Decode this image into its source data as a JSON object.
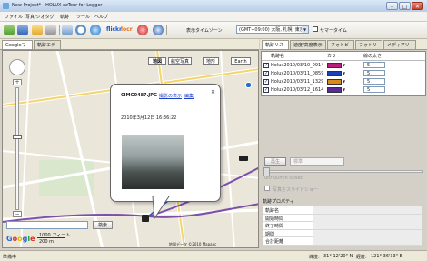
{
  "window": {
    "title": "New Project* - HOLUX ezTour for Logger",
    "minimize": "–",
    "maximize": "□",
    "close": "✕"
  },
  "menu": [
    "ファイル",
    "写真/ジオタグ",
    "軌跡",
    "ツール",
    "ヘルプ"
  ],
  "toolbar": {
    "icons": [
      "import-icon",
      "save-icon",
      "open-folder-icon",
      "photo-icon",
      "route-icon",
      "clock-icon",
      "google-earth-icon",
      "flickr-icon",
      "locr-icon",
      "eye-fi-icon",
      "globe-icon"
    ],
    "flickr_label": "flickr",
    "locr_label": "locr",
    "timezone_label": "表示タイムゾーン",
    "timezone_value": "(GMT+09:00) 大阪, 札幌, 東京",
    "dst_label": "サマータイム"
  },
  "left_tabs": [
    "Googleマップ",
    "軌跡エディタ"
  ],
  "map": {
    "type_buttons": [
      "地図",
      "航空写真",
      "地形",
      "Earth"
    ],
    "zoom_in": "+",
    "zoom_out": "−",
    "popup": {
      "filename": "CIMG0487.JPG",
      "separator": "-",
      "link_original": "撮影の表示",
      "link_edit": "編集",
      "close": "✕",
      "datetime": "2010年3月12日   16:36:22"
    },
    "search_button": "検索",
    "scale_top": "1000 フィート",
    "scale_bottom": "200 m",
    "google_logo": "Google",
    "copyright": "地図データ ©2010 Mapabc"
  },
  "right_tabs": [
    "軌跡リスト",
    "速度/高度表示",
    "フォトビュー",
    "フォトリスト",
    "メディアリスト"
  ],
  "track_list": {
    "headers": [
      "軌跡名",
      "カラー",
      "線の太さ"
    ],
    "rows": [
      {
        "name": "Holux2010/03/10_0914",
        "color": "#b81f78",
        "width": "5"
      },
      {
        "name": "Holux2010/03/11_0859",
        "color": "#1a3fb8",
        "width": "5"
      },
      {
        "name": "Holux2010/03/11_1329",
        "color": "#d88a1c",
        "width": "5"
      },
      {
        "name": "Holux2010/03/12_1614",
        "color": "#5b2a9a",
        "width": "5"
      }
    ]
  },
  "playback": {
    "play_label": "再生",
    "speed_label": "標準",
    "duration": "0hr 00min 00sec",
    "slider_option": "写真をスライドショー"
  },
  "properties": {
    "title": "軌跡プロパティ",
    "rows": [
      "軌跡名",
      "開始時間",
      "終了時間",
      "期間",
      "合計距離"
    ]
  },
  "status": {
    "left": "準備中",
    "lat_label": "緯度:",
    "lat": "31° 12'20\" N",
    "lon_label": "経度:",
    "lon": "121° 36'33\" E"
  }
}
